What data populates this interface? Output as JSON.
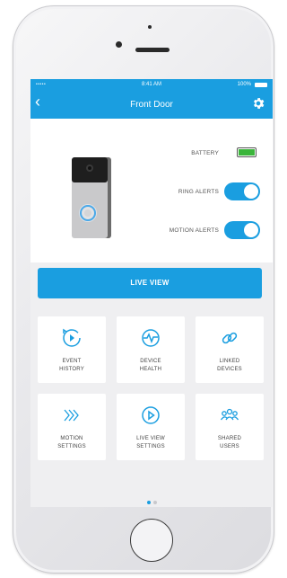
{
  "status_bar": {
    "signal": "•••••",
    "time": "8:41 AM",
    "battery": "100%"
  },
  "header": {
    "title": "Front Door",
    "back_icon": "chevron-left-icon",
    "settings_icon": "gear-icon"
  },
  "device": {
    "image": "ring-doorbell-image"
  },
  "settings": {
    "battery_label": "BATTERY",
    "battery_level": 1.0,
    "ring_alerts_label": "RING ALERTS",
    "ring_alerts_on": true,
    "motion_alerts_label": "MOTION ALERTS",
    "motion_alerts_on": true
  },
  "live_view_label": "LIVE VIEW",
  "tiles": [
    {
      "line1": "EVENT",
      "line2": "HISTORY",
      "icon": "event-history-icon"
    },
    {
      "line1": "DEVICE",
      "line2": "HEALTH",
      "icon": "device-health-icon"
    },
    {
      "line1": "LINKED",
      "line2": "DEVICES",
      "icon": "linked-devices-icon"
    },
    {
      "line1": "MOTION",
      "line2": "SETTINGS",
      "icon": "motion-settings-icon"
    },
    {
      "line1": "LIVE VIEW",
      "line2": "SETTINGS",
      "icon": "live-view-settings-icon"
    },
    {
      "line1": "SHARED",
      "line2": "USERS",
      "icon": "shared-users-icon"
    }
  ],
  "page_indicator": {
    "active_index": 0,
    "count": 2
  },
  "colors": {
    "brand_blue": "#1a9ee0",
    "battery_green": "#3bb53b",
    "screen_background": "#efeff1"
  }
}
